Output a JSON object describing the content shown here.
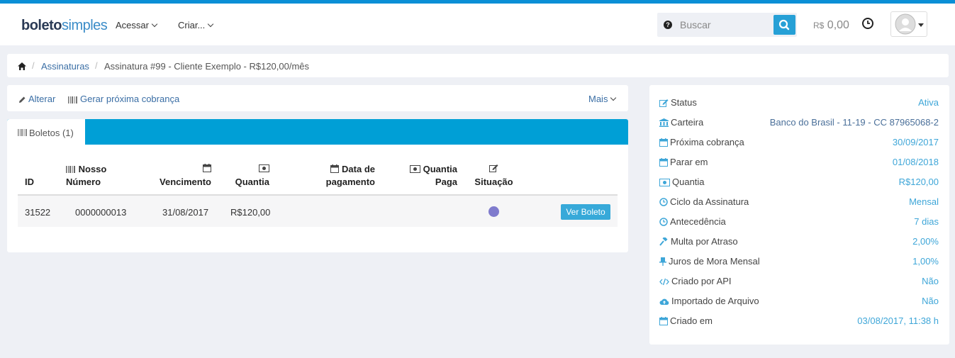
{
  "header": {
    "logo_bold": "boleto",
    "logo_light": "simples",
    "nav": [
      {
        "label": "Acessar"
      },
      {
        "label": "Criar..."
      }
    ],
    "search_placeholder": "Buscar",
    "balance_currency": "R$",
    "balance_value": "0,00"
  },
  "breadcrumb": {
    "items": [
      "Assinaturas",
      "Assinatura #99 - Cliente Exemplo - R$120,00/mês"
    ]
  },
  "toolbar": {
    "edit_label": "Alterar",
    "generate_label": "Gerar próxima cobrança",
    "more_label": "Mais"
  },
  "boletos": {
    "tab_label": "Boletos (1)",
    "columns": {
      "id": "ID",
      "nosso_1": "Nosso",
      "nosso_2": "Número",
      "vencimento": "Vencimento",
      "quantia": "Quantia",
      "data_1": "Data de",
      "data_2": "pagamento",
      "qp_1": "Quantia",
      "qp_2": "Paga",
      "situacao": "Situação"
    },
    "rows": [
      {
        "id": "31522",
        "nosso_numero": "0000000013",
        "vencimento": "31/08/2017",
        "quantia": "R$120,00",
        "data_pagamento": "",
        "quantia_paga": "",
        "situacao_color": "#7f7bcd",
        "action": "Ver Boleto"
      }
    ]
  },
  "details": [
    {
      "key": "Status",
      "value": "Ativa",
      "icon": "edit-icon"
    },
    {
      "key": "Carteira",
      "value": "Banco do Brasil - 11-19 - CC 87965068-2",
      "icon": "bank-icon"
    },
    {
      "key": "Próxima cobrança",
      "value": "30/09/2017",
      "icon": "calendar-icon"
    },
    {
      "key": "Parar em",
      "value": "01/08/2018",
      "icon": "calendar-icon"
    },
    {
      "key": "Quantia",
      "value": "R$120,00",
      "icon": "money-icon"
    },
    {
      "key": "Ciclo da Assinatura",
      "value": "Mensal",
      "icon": "clock-icon"
    },
    {
      "key": "Antecedência",
      "value": "7 dias",
      "icon": "clock-icon"
    },
    {
      "key": "Multa por Atraso",
      "value": "2,00%",
      "icon": "gavel-icon"
    },
    {
      "key": "Juros de Mora Mensal",
      "value": "1,00%",
      "icon": "pin-icon"
    },
    {
      "key": "Criado por API",
      "value": "Não",
      "icon": "code-icon"
    },
    {
      "key": "Importado de Arquivo",
      "value": "Não",
      "icon": "cloud-icon"
    },
    {
      "key": "Criado em",
      "value": "03/08/2017, 11:38 h",
      "icon": "calendar-icon"
    }
  ],
  "colors": {
    "accent": "#009fd6",
    "link": "#3ea6d8",
    "status_dot": "#7f7bcd"
  }
}
